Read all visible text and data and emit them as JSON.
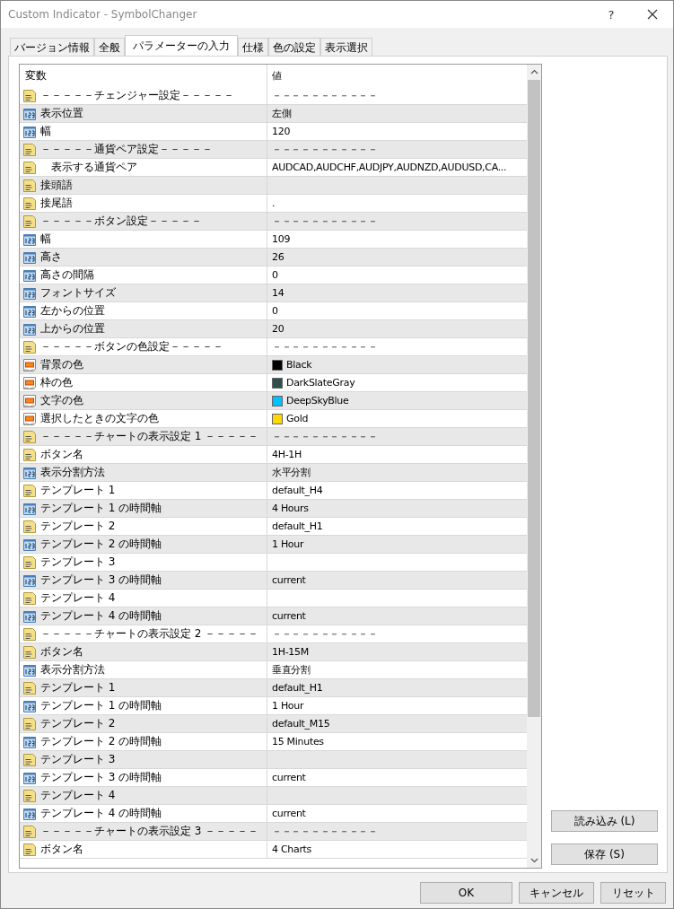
{
  "window": {
    "title": "Custom Indicator - SymbolChanger",
    "help": "?"
  },
  "tabs": [
    {
      "label": "バージョン情報",
      "selected": false
    },
    {
      "label": "全般",
      "selected": false
    },
    {
      "label": "パラメーターの入力",
      "selected": true
    },
    {
      "label": "仕様",
      "selected": false
    },
    {
      "label": "色の設定",
      "selected": false
    },
    {
      "label": "表示選択",
      "selected": false
    }
  ],
  "table": {
    "columns": [
      "変数",
      "値"
    ],
    "rows": [
      {
        "kind": "text",
        "name": "－－－－－チェンジャー設定－－－－－",
        "value": "－－－－－－－－－－－"
      },
      {
        "kind": "int",
        "name": "表示位置",
        "value": "左側"
      },
      {
        "kind": "int",
        "name": "幅",
        "value": "120"
      },
      {
        "kind": "text",
        "name": "－－－－－通貨ペア設定－－－－－",
        "value": "－－－－－－－－－－－"
      },
      {
        "kind": "text",
        "name": "　表示する通貨ペア",
        "value": "AUDCAD,AUDCHF,AUDJPY,AUDNZD,AUDUSD,CA..."
      },
      {
        "kind": "text",
        "name": "接頭語"
      },
      {
        "kind": "text",
        "name": "接尾語",
        "value": "."
      },
      {
        "kind": "text",
        "name": "－－－－－ボタン設定－－－－－",
        "value": "－－－－－－－－－－－"
      },
      {
        "kind": "int",
        "name": "幅",
        "value": "109"
      },
      {
        "kind": "int",
        "name": "高さ",
        "value": "26"
      },
      {
        "kind": "int",
        "name": "高さの間隔",
        "value": "0"
      },
      {
        "kind": "int",
        "name": "フォントサイズ",
        "value": "14"
      },
      {
        "kind": "int",
        "name": "左からの位置",
        "value": "0"
      },
      {
        "kind": "int",
        "name": "上からの位置",
        "value": "20"
      },
      {
        "kind": "text",
        "name": "－－－－－ボタンの色設定－－－－－",
        "value": "－－－－－－－－－－－"
      },
      {
        "kind": "color",
        "name": "背景の色",
        "value": "Black",
        "color": "#000000"
      },
      {
        "kind": "color",
        "name": "枠の色",
        "value": "DarkSlateGray",
        "color": "#2f4f4f"
      },
      {
        "kind": "color",
        "name": "文字の色",
        "value": "DeepSkyBlue",
        "color": "#00bfff"
      },
      {
        "kind": "color",
        "name": "選択したときの文字の色",
        "value": "Gold",
        "color": "#ffd700"
      },
      {
        "kind": "text",
        "name": "－－－－－チャートの表示設定 1 －－－－－",
        "value": "－－－－－－－－－－－"
      },
      {
        "kind": "text",
        "name": "ボタン名",
        "value": "4H-1H"
      },
      {
        "kind": "int",
        "name": "表示分割方法",
        "value": "水平分割"
      },
      {
        "kind": "text",
        "name": "テンプレート 1",
        "value": "default_H4"
      },
      {
        "kind": "int",
        "name": "テンプレート 1 の時間軸",
        "value": "4 Hours"
      },
      {
        "kind": "text",
        "name": "テンプレート 2",
        "value": "default_H1"
      },
      {
        "kind": "int",
        "name": "テンプレート 2 の時間軸",
        "value": "1 Hour"
      },
      {
        "kind": "text",
        "name": "テンプレート 3"
      },
      {
        "kind": "int",
        "name": "テンプレート 3 の時間軸",
        "value": "current"
      },
      {
        "kind": "text",
        "name": "テンプレート 4"
      },
      {
        "kind": "int",
        "name": "テンプレート 4 の時間軸",
        "value": "current"
      },
      {
        "kind": "text",
        "name": "－－－－－チャートの表示設定 2 －－－－－",
        "value": "－－－－－－－－－－－"
      },
      {
        "kind": "text",
        "name": "ボタン名",
        "value": "1H-15M"
      },
      {
        "kind": "int",
        "name": "表示分割方法",
        "value": "垂直分割"
      },
      {
        "kind": "text",
        "name": "テンプレート 1",
        "value": "default_H1"
      },
      {
        "kind": "int",
        "name": "テンプレート 1 の時間軸",
        "value": "1 Hour"
      },
      {
        "kind": "text",
        "name": "テンプレート 2",
        "value": "default_M15"
      },
      {
        "kind": "int",
        "name": "テンプレート 2 の時間軸",
        "value": "15 Minutes"
      },
      {
        "kind": "text",
        "name": "テンプレート 3"
      },
      {
        "kind": "int",
        "name": "テンプレート 3 の時間軸",
        "value": "current"
      },
      {
        "kind": "text",
        "name": "テンプレート 4"
      },
      {
        "kind": "int",
        "name": "テンプレート 4 の時間軸",
        "value": "current"
      },
      {
        "kind": "text",
        "name": "－－－－－チャートの表示設定 3 －－－－－",
        "value": "－－－－－－－－－－－"
      },
      {
        "kind": "text",
        "name": "ボタン名",
        "value": "4 Charts"
      }
    ]
  },
  "side_buttons": [
    "読み込み (L)",
    "保存 (S)"
  ],
  "buttons": [
    "OK",
    "キャンセル",
    "リセット"
  ]
}
